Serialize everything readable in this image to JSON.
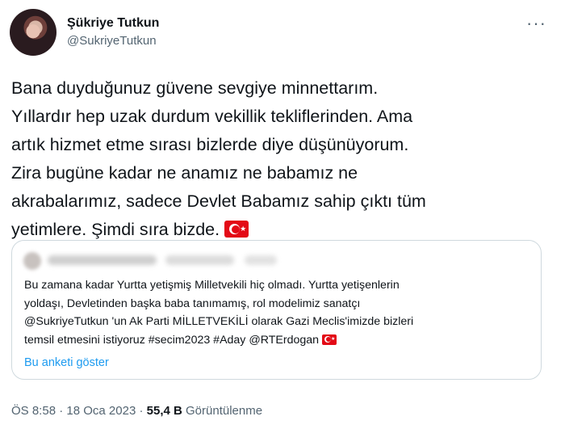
{
  "author": {
    "name": "Şükriye Tutkun",
    "handle": "@SukriyeTutkun"
  },
  "more_icon": "more-horizontal-icon",
  "tweet_text": "Bana duyduğunuz güvene sevgiye minnettarım.\nYıllardır hep uzak durdum vekillik tekliflerinden. Ama\nartık hizmet etme sırası bizlerde diye düşünüyorum.\nZira bugüne kadar ne anamız ne babamız ne\nakrabalarımız, sadece Devlet Babamız sahip çıktı tüm\nyetimlere. Şimdi sıra bizde.",
  "quote": {
    "text": "Bu zamana kadar Yurtta yetişmiş Milletvekili hiç olmadı. Yurtta yetişenlerin\nyoldaşı, Devletinden başka baba tanımamış, rol modelimiz sanatçı\n@SukriyeTutkun 'un Ak Parti MİLLETVEKİLİ olarak  Gazi Meclis'imizde bizleri\ntemsil etmesini istiyoruz #secim2023 #Aday @RTErdogan",
    "poll_link": "Bu anketi göster"
  },
  "meta": {
    "time": "ÖS 8:58",
    "sep": " · ",
    "date": "18 Oca 2023",
    "views_count": "55,4 B",
    "views_label": " Görüntülenme"
  },
  "colors": {
    "text": "#0f1419",
    "secondary": "#536471",
    "link": "#1d9bf0",
    "border": "#cfd9de",
    "flag_red": "#e30a17"
  }
}
